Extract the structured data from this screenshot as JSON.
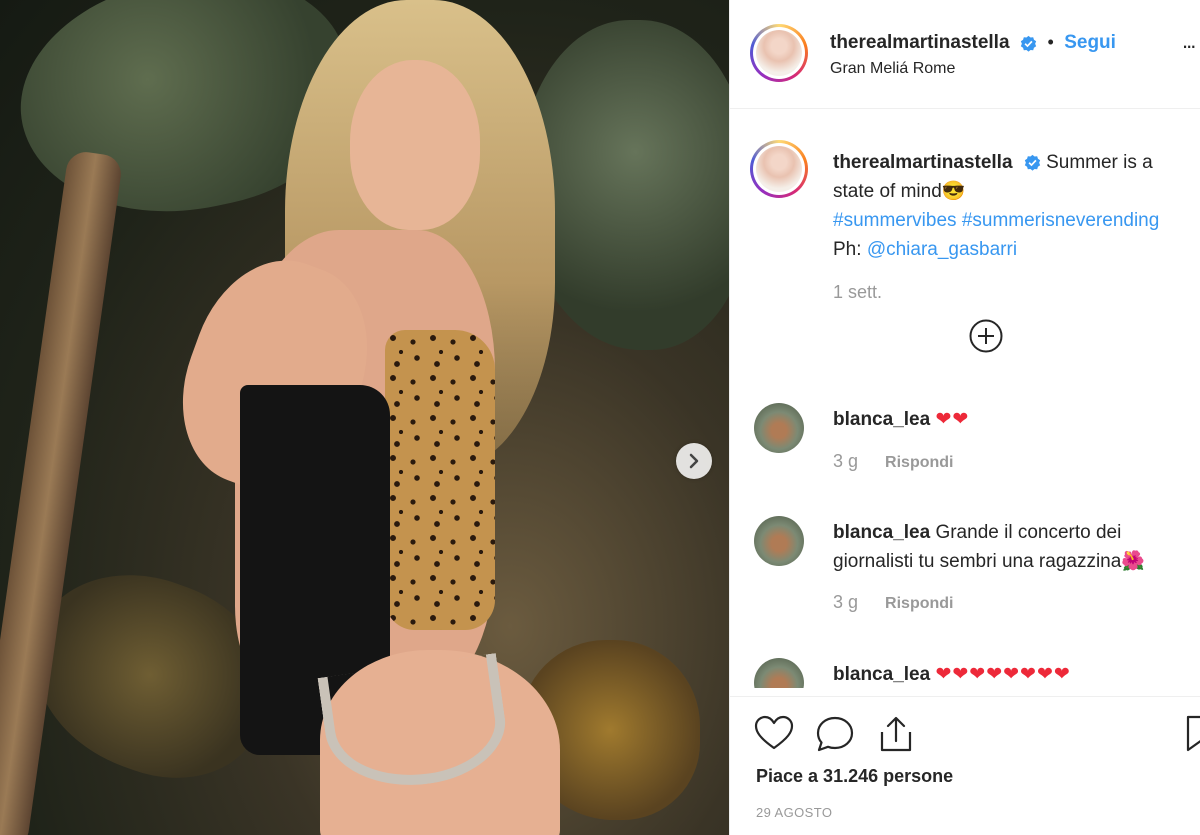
{
  "post": {
    "username": "therealmartinastella",
    "follow_label": "Segui",
    "separator": "•",
    "location": "Gran Meliá Rome",
    "more_label": "..."
  },
  "caption": {
    "username": "therealmartinastella",
    "text_line1": "Summer is a",
    "text_line2": "state of mind😎",
    "hashtags": "#summervibes #summerisneverending",
    "photo_prefix": "Ph: ",
    "photo_credit": "@chiara_gasbarri",
    "time": "1 sett."
  },
  "comments": [
    {
      "username": "blanca_lea",
      "text": "",
      "hearts": "❤❤",
      "time": "3 g",
      "reply_label": "Rispondi"
    },
    {
      "username": "blanca_lea",
      "text_line1": "Grande il concerto dei",
      "text_line2": "giornalisti tu sembri una ragazzina🌺",
      "time": "3 g",
      "reply_label": "Rispondi"
    },
    {
      "username": "blanca_lea",
      "text": "",
      "hearts": "❤❤❤❤❤❤❤❤"
    }
  ],
  "footer": {
    "likes": "Piace a 31.246 persone",
    "date": "29 AGOSTO"
  },
  "icons": {
    "verified": "verified-badge-icon",
    "next": "chevron-right-icon",
    "load_more": "plus-circle-icon",
    "like": "heart-icon",
    "comment": "comment-icon",
    "share": "share-icon",
    "save": "bookmark-icon"
  },
  "colors": {
    "link": "#3897f0",
    "heart": "#ed2939",
    "muted": "#999999"
  }
}
